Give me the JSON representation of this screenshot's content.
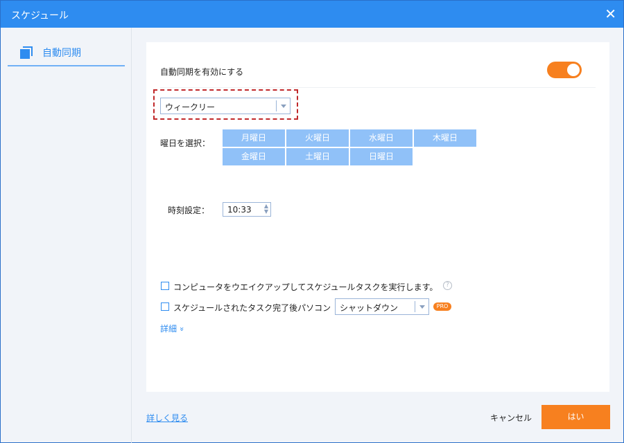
{
  "window": {
    "title": "スケジュール",
    "close": "✕"
  },
  "sidebar": {
    "items": [
      {
        "label": "自動同期"
      }
    ]
  },
  "main": {
    "enable_label": "自動同期を有効にする",
    "enable_on": true,
    "frequency": "ウィークリー",
    "days_label": "曜日を選択：",
    "days": [
      "月曜日",
      "火曜日",
      "水曜日",
      "木曜日",
      "金曜日",
      "土曜日",
      "日曜日"
    ],
    "time_label": "時刻設定：",
    "time": "10:33",
    "wake_label": "コンピュータをウエイクアップしてスケジュールタスクを実行します。",
    "help": "?",
    "after_label": "スケジュールされたタスク完了後パソコン",
    "after_action": "シャットダウン",
    "pro": "PRO",
    "details": "詳細",
    "details_icon": "»"
  },
  "footer": {
    "learn_more": "詳しく見る",
    "cancel": "キャンセル",
    "ok": "はい"
  },
  "colors": {
    "accent": "#2e8cf0",
    "orange": "#f7801f",
    "day": "#90c1f8"
  }
}
